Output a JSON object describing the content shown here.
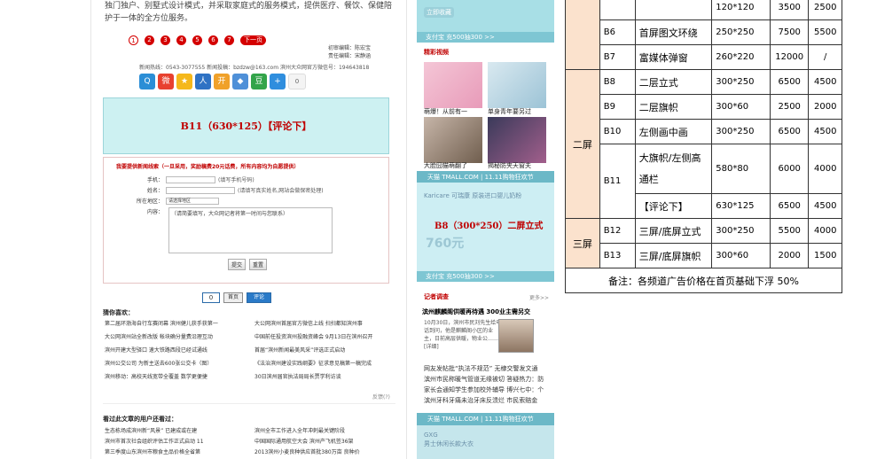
{
  "article": {
    "intro": "独门独户、别墅式设计模式，并采取家庭式的服务模式，提供医疗、餐饮、保健陪护于一体的全方位服务。",
    "pages": [
      "1",
      "2",
      "3",
      "4",
      "5",
      "6",
      "7"
    ],
    "next_label": "下一页",
    "editor_label": "初审编辑：陈宏宝",
    "editor2_label": "责任编辑：宋静涵",
    "hotline": "新闻热线：0543-3077555    新闻投稿：bzdzw@163.com    滨州大众网官方微信号：194643818"
  },
  "share": {
    "buttons": [
      "qq",
      "weibo",
      "qzone",
      "renren",
      "kaixin",
      "douban",
      "tsina",
      "more"
    ],
    "count": "0"
  },
  "ad_b11": {
    "label": "B11（630*125）【评论下】"
  },
  "form": {
    "title": "我要提供新闻线索（一旦采用，奖励稿费20元话费，所有内容均为自愿提供）",
    "phone_label": "手机：",
    "phone_hint": "(填写手机号码)",
    "name_label": "姓名：",
    "name_hint": "(请填写真实姓名,网站会做保密处理)",
    "area_label": "所在地区：",
    "area_value": "请选择地区",
    "content_label": "内容：",
    "content_placeholder": "（请简要填写，大众网记者将第一时间与您联系）",
    "submit": "提交",
    "reset": "重置"
  },
  "comments": {
    "count": "0",
    "label": "首页",
    "button": "评论"
  },
  "guess": {
    "title": "猜你喜欢：",
    "items": [
      "第二届环渤海自行车赛闭幕 滨州健儿获手获第一",
      "大公网滨州首届官方微信上线 扫扫都知滨州事",
      "大公网滨州站全新改版 帐块确分量费沿理互动",
      "中国前任投资滨州投融资峰会 9月13日在滨州召开",
      "滨州开建大型驿口 速大铁路西段已经试通线",
      "首届“滨州新闻最美风采”评选正式启动",
      "滨州公交公司 为新主送去600张公交卡（图）",
      "《法治滨州建设实践纲要》征求意见稿第一稿完成",
      "滨州移动：高校天线宽带全覆盖 数学更便捷",
      "30日滨州届官执法局局长贾学利访谈"
    ],
    "feedback": "反馈(?)"
  },
  "related": {
    "title": "看过此文章的用户还看过：",
    "items": [
      "生态栋场成滨州新“风景” 已建成或在建",
      "滨州全市工作进入全年冲刺最关键阶段",
      "滨州市首次社会组织评估工作正式启动 11",
      "中国国际通用航空大会 滨州产飞机签36架",
      "第三季度山东滨州市粮食主品价格全省第",
      "2013滨州小麦良种供应首批380万亩 良种价"
    ]
  },
  "middle": {
    "collect_label": "立即收藏",
    "pay_label": "支付宝 充500抽300 >>",
    "video_title": "精彩视频",
    "videos": [
      {
        "caption": "萌爆！从前有一"
      },
      {
        "caption": "单身青年要另过"
      },
      {
        "caption": "大脸囧猫萌翻了"
      },
      {
        "caption": "揭秘防夹天窗夫"
      }
    ],
    "tmall_label": "天猫 TMALL.COM | 11.11购物狂欢节",
    "b8_brand": "Karicare 可瑞康\n原装进口婴儿奶粉",
    "b8_price": "760元",
    "b8_label": "B8（300*250）二屏立式",
    "reporter_title": "记者调查",
    "more": "更多>>",
    "headline": "滨州麒麟阁供暖再待遇 300业主需另交",
    "headline_sub": "10月30日，滨州市民刘先生给电话到问，他是麒麟阁小区的业主，日前高层供暖，物业公……[详细]",
    "news_lines": [
      "网友发帖批“执法不规范” 无棣交警发文通",
      "滨州市民称暖气管道无缘被切 答疑热力：防",
      "家长会通知学生参加校外辅导 博兴七中：个",
      "滨州牙科牙痛未治牙床反溃烂 市民索赔金"
    ],
    "tmall2_label": "天猫 TMALL.COM | 11.11购物狂欢节",
    "gxg_label": "GXG\n男士休闲长款大衣"
  },
  "price_table": {
    "zone_first": "",
    "zone_second": "二屏",
    "zone_third": "三屏",
    "rows": [
      {
        "code": "",
        "name": "",
        "size": "120*120",
        "p1": "3500",
        "p2": "2500"
      },
      {
        "code": "B6",
        "name": "首屏图文环绕",
        "size": "250*250",
        "p1": "7500",
        "p2": "5500"
      },
      {
        "code": "B7",
        "name": "富媒体弹窗",
        "size": "260*220",
        "p1": "12000",
        "p2": "/"
      },
      {
        "code": "B8",
        "name": "二层立式",
        "size": "300*250",
        "p1": "6500",
        "p2": "4500"
      },
      {
        "code": "B9",
        "name": "二层旗帜",
        "size": "300*60",
        "p1": "2500",
        "p2": "2000"
      },
      {
        "code": "B10",
        "name": "左侧画中画",
        "size": "300*250",
        "p1": "6500",
        "p2": "4500"
      },
      {
        "code": "B11",
        "name": "大旗帜/左侧高通栏",
        "size": "580*80",
        "p1": "6000",
        "p2": "4000"
      },
      {
        "code": "",
        "name": "【评论下】",
        "size": "630*125",
        "p1": "6500",
        "p2": "4500"
      },
      {
        "code": "B12",
        "name": "三屏/底屏立式",
        "size": "300*250",
        "p1": "5500",
        "p2": "4000"
      },
      {
        "code": "B13",
        "name": "三屏/底屏旗帜",
        "size": "300*60",
        "p1": "2000",
        "p2": "1500"
      }
    ],
    "note": "备注：各频道广告价格在首页基础下浮 50%"
  }
}
